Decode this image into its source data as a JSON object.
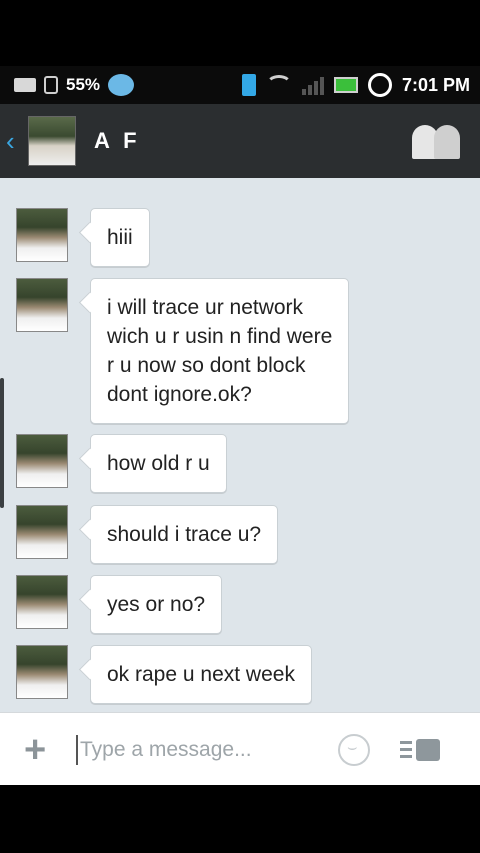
{
  "status_bar": {
    "battery_percent_label": "55%",
    "time": "7:01 PM",
    "icons": [
      "sim-icon",
      "usb-icon",
      "chat-notification-icon",
      "phone-vibrate-icon",
      "wifi-icon",
      "signal-icon",
      "battery-icon",
      "alarm-clock-icon"
    ]
  },
  "header": {
    "title": "A F"
  },
  "messages": [
    {
      "text": "hiii"
    },
    {
      "text": "i will trace ur network\nwich u r usin n find were\nr u now so dont block\ndont ignore.ok?"
    },
    {
      "text": "how old r u"
    },
    {
      "text": "should i trace u?"
    },
    {
      "text": "yes or no?"
    },
    {
      "text": "ok rape u next week"
    }
  ],
  "input": {
    "placeholder": "Type a message..."
  },
  "colors": {
    "header_bg": "#2b2e30",
    "chat_bg": "#dee5ea",
    "accent_blue": "#3aa6e0"
  }
}
